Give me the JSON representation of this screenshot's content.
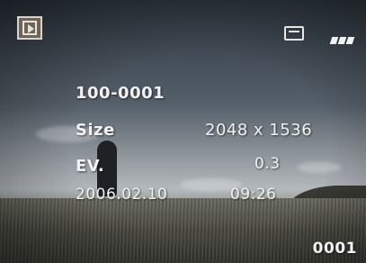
{
  "status": {
    "mode_icon": "play-icon",
    "memory_icon": "memory-card-icon",
    "battery_icon": "battery-icon"
  },
  "info": {
    "file_number": "100-0001",
    "size_label": "Size",
    "size_value": "2048 x 1536",
    "ev_label": "EV.",
    "ev_value": "0.3",
    "date": "2006.02.10",
    "time": "09:26"
  },
  "image_counter": "0001"
}
